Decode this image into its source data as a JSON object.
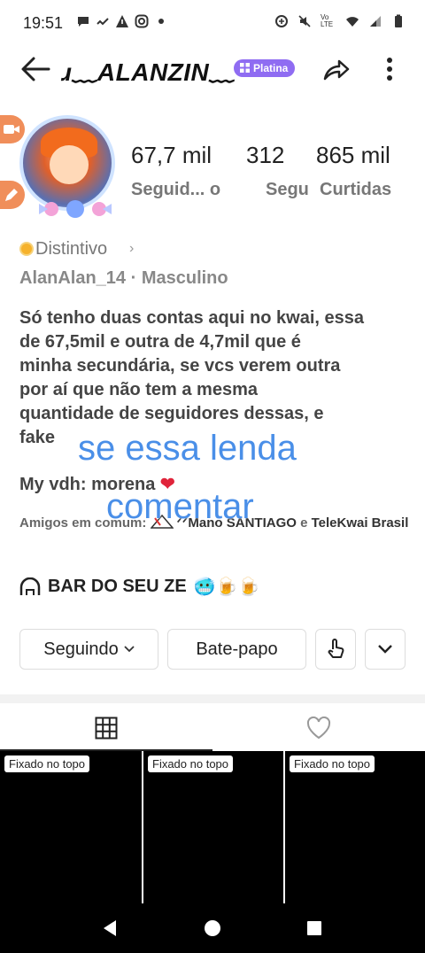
{
  "status_bar": {
    "time": "19:51",
    "network_label": "Vo LTE"
  },
  "header": {
    "profile_name": "ɹ﹏ALANZIN﹏",
    "badge": "Platina"
  },
  "stats": [
    {
      "number": "67,7 mil",
      "label": "Seguid... o"
    },
    {
      "number": "312",
      "label": "Segu"
    },
    {
      "number": "865 mil",
      "label": "Curtidas"
    }
  ],
  "profile": {
    "distintivo": "Distintivo",
    "user_meta": "AlanAlan_14 · Masculino",
    "bio_lines": [
      "Só tenho duas contas aqui no kwai, essa",
      "de 67,5mil e outra de 4,7mil que é",
      "minha secundária, se vcs verem outra",
      "por aí que não tem a mesma",
      "quantidade de seguidores dessas, e",
      "fake"
    ],
    "my_vdh": "My vdh: morena",
    "my_vdh_emoji": "❤",
    "friends_prefix": "Amigos em comum:",
    "friend_1": "ᐟᐟMano SANTIAGO",
    "friends_and": "e",
    "friend_2": "TeleKwai Brasil",
    "bar_text": "BAR DO SEU ZE",
    "bar_emojis": "🥶🍺🍺"
  },
  "overlay": {
    "line_1": "se essa lenda",
    "line_2": "comentar"
  },
  "buttons": {
    "following": "Seguindo",
    "chat": "Bate-papo"
  },
  "tabs": {
    "grid_icon": "grid-icon",
    "liked_icon": "heart-outline-icon"
  },
  "videos": [
    {
      "pinned": "Fixado no topo"
    },
    {
      "pinned": "Fixado no topo"
    },
    {
      "pinned": "Fixado no topo"
    }
  ],
  "colors": {
    "badge": "#8f6cf2",
    "overlay_text": "#4a8fe8",
    "heart": "#e0243a",
    "side_tab": "#f08e5a"
  }
}
